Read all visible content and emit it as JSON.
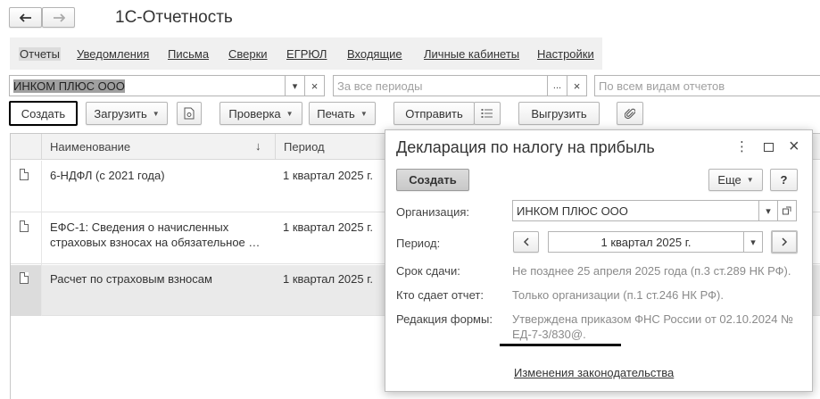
{
  "window": {
    "title": "1С-Отчетность"
  },
  "nav": {
    "items": [
      "Отчеты",
      "Уведомления",
      "Письма",
      "Сверки",
      "ЕГРЮЛ",
      "Входящие",
      "Личные кабинеты",
      "Настройки"
    ]
  },
  "filters": {
    "organization": "ИНКОМ ПЛЮС ООО",
    "period_placeholder": "За все периоды",
    "kinds_placeholder": "По всем видам отчетов",
    "more": "...",
    "clear": "×",
    "dropdown": "▾"
  },
  "toolbar": {
    "create": "Создать",
    "load": "Загрузить",
    "check": "Проверка",
    "print": "Печать",
    "send": "Отправить",
    "export": "Выгрузить"
  },
  "table": {
    "headers": {
      "name": "Наименование",
      "period": "Период",
      "sort": "↓"
    },
    "rows": [
      {
        "name": "6-НДФЛ (с 2021 года)",
        "name2": "",
        "period": "1 квартал 2025 г."
      },
      {
        "name": "ЕФС-1: Сведения о начисленных",
        "name2": "страховых взносах на обязательное …",
        "period": "1 квартал 2025 г."
      },
      {
        "name": "Расчет по страховым взносам",
        "name2": "",
        "period": "1 квартал 2025 г."
      }
    ]
  },
  "dialog": {
    "title": "Декларация по налогу на прибыль",
    "create": "Создать",
    "more": "Еще",
    "help": "?",
    "org_label": "Организация:",
    "org_value": "ИНКОМ ПЛЮС ООО",
    "period_label": "Период:",
    "period_value": "1 квартал 2025 г.",
    "deadline_label": "Срок сдачи:",
    "deadline_value": "Не позднее 25 апреля 2025 года (п.3 ст.289 НК РФ).",
    "who_label": "Кто сдает отчет:",
    "who_value": "Только организации (п.1 ст.246 НК РФ).",
    "edition_label": "Редакция формы:",
    "edition_line1": "Утверждена приказом ФНС России от 02.10.2024 №",
    "edition_line2": "ЕД-7-3/830@.",
    "law_changes": "Изменения законодательства"
  },
  "colors": {
    "selected_row": "#eaeaea",
    "header_bg": "#f2f2f2",
    "focus_border": "#000000"
  }
}
